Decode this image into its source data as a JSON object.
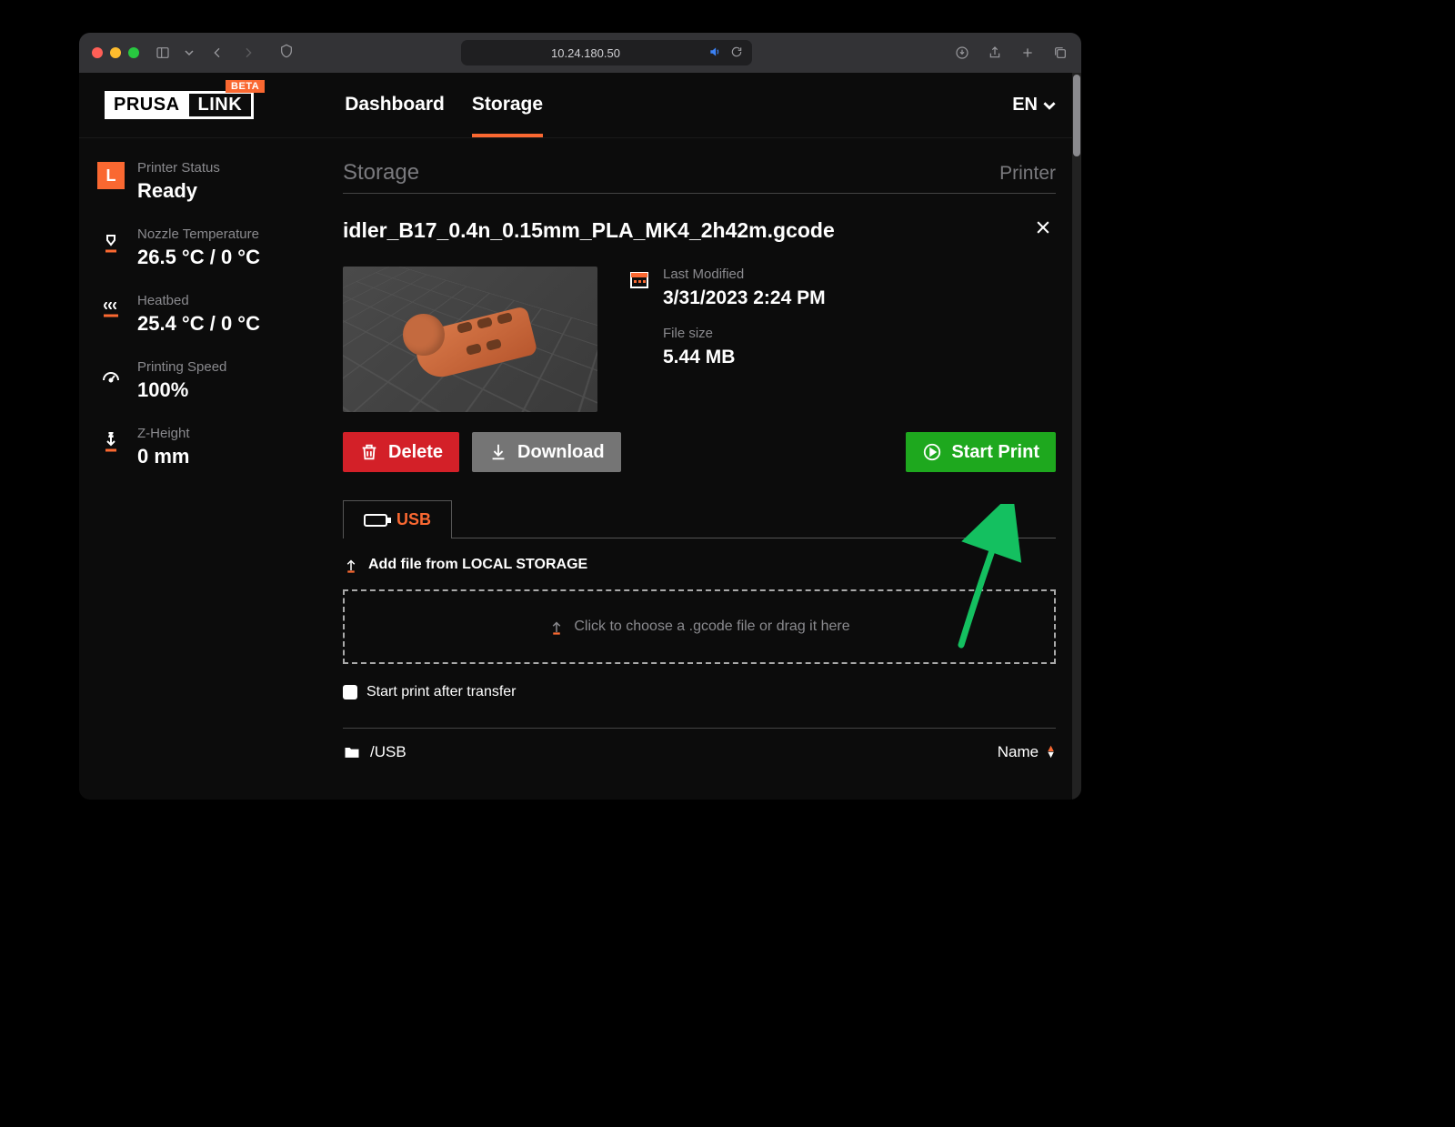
{
  "browser": {
    "url": "10.24.180.50"
  },
  "logo": {
    "prusa": "PRUSA",
    "link": "LINK",
    "beta": "BETA"
  },
  "nav": {
    "dashboard": "Dashboard",
    "storage": "Storage"
  },
  "lang": "EN",
  "sidebar": {
    "letter": "L",
    "status_label": "Printer Status",
    "status_value": "Ready",
    "nozzle_label": "Nozzle Temperature",
    "nozzle_value": "26.5 °C / 0 °C",
    "bed_label": "Heatbed",
    "bed_value": "25.4 °C / 0 °C",
    "speed_label": "Printing Speed",
    "speed_value": "100%",
    "z_label": "Z-Height",
    "z_value": "0 mm"
  },
  "page": {
    "title": "Storage",
    "subtitle": "Printer"
  },
  "file": {
    "name": "idler_B17_0.4n_0.15mm_PLA_MK4_2h42m.gcode",
    "modified_label": "Last Modified",
    "modified_value": "3/31/2023 2:24 PM",
    "size_label": "File size",
    "size_value": "5.44 MB"
  },
  "actions": {
    "delete": "Delete",
    "download": "Download",
    "start": "Start Print"
  },
  "tabs": {
    "usb": "USB"
  },
  "upload": {
    "addfile": "Add file from LOCAL STORAGE",
    "dropzone": "Click to choose a .gcode file or drag it here",
    "checkbox": "Start print after transfer"
  },
  "path": {
    "current": "/USB",
    "sort": "Name"
  }
}
